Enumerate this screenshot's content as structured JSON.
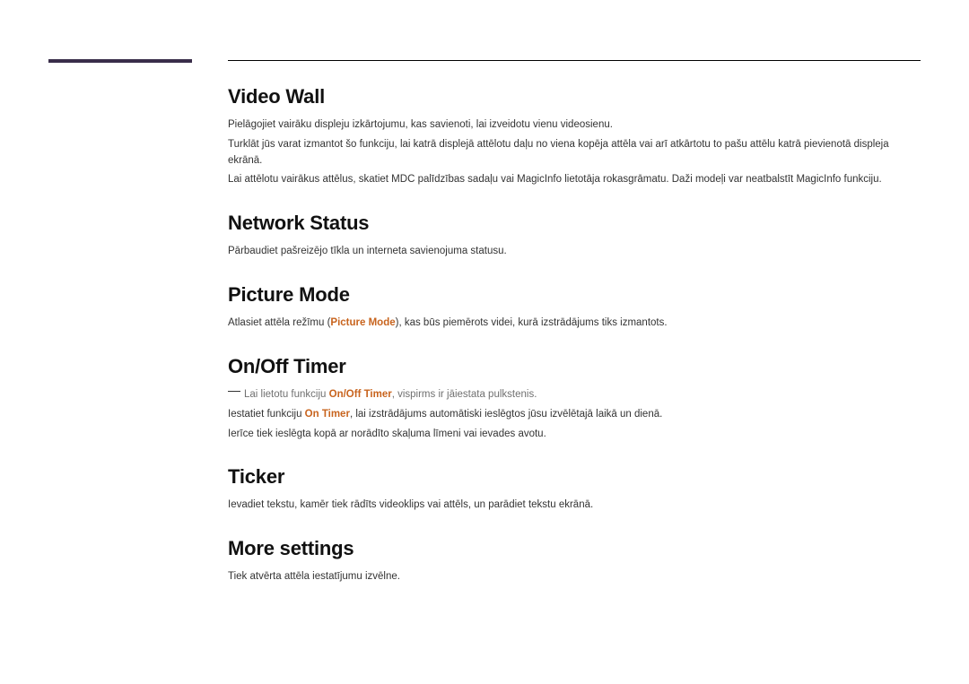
{
  "sections": [
    {
      "title": "Video Wall",
      "paras": [
        {
          "type": "plain",
          "text": "Pielāgojiet vairāku displeju izkārtojumu, kas savienoti, lai izveidotu vienu videosienu."
        },
        {
          "type": "plain",
          "text": "Turklāt jūs varat izmantot šo funkciju, lai katrā displejā attēlotu daļu no viena kopēja attēla vai arī atkārtotu to pašu attēlu katrā pievienotā displeja ekrānā."
        },
        {
          "type": "plain",
          "text": "Lai attēlotu vairākus attēlus, skatiet MDC palīdzības sadaļu vai MagicInfo lietotāja rokasgrāmatu. Daži modeļi var neatbalstīt MagicInfo funkciju."
        }
      ]
    },
    {
      "title": "Network Status",
      "paras": [
        {
          "type": "plain",
          "text": "Pārbaudiet pašreizējo tīkla un interneta savienojuma statusu."
        }
      ]
    },
    {
      "title": "Picture Mode",
      "paras": [
        {
          "type": "inline",
          "pre": "Atlasiet attēla režīmu (",
          "bold": "Picture Mode",
          "post": "), kas būs piemērots videi, kurā izstrādājums tiks izmantots."
        }
      ]
    },
    {
      "title": "On/Off Timer",
      "paras": [
        {
          "type": "note",
          "pre": "Lai lietotu funkciju ",
          "bold": "On/Off Timer",
          "post": ", vispirms ir jāiestata pulkstenis."
        },
        {
          "type": "inline",
          "pre": "Iestatiet funkciju ",
          "bold": "On Timer",
          "post": ", lai izstrādājums automātiski ieslēgtos jūsu izvēlētajā laikā un dienā."
        },
        {
          "type": "plain",
          "text": "Ierīce tiek ieslēgta kopā ar norādīto skaļuma līmeni vai ievades avotu."
        }
      ]
    },
    {
      "title": "Ticker",
      "paras": [
        {
          "type": "plain",
          "text": "Ievadiet tekstu, kamēr tiek rādīts videoklips vai attēls, un parādiet tekstu ekrānā."
        }
      ]
    },
    {
      "title": "More settings",
      "paras": [
        {
          "type": "plain",
          "text": "Tiek atvērta attēla iestatījumu izvēlne."
        }
      ]
    }
  ]
}
